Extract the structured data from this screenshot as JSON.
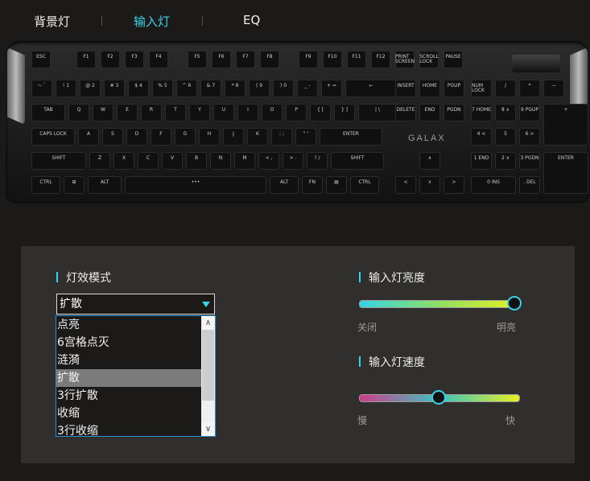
{
  "tabs": [
    {
      "label": "背景灯"
    },
    {
      "label": "输入灯"
    },
    {
      "label": "EQ"
    }
  ],
  "keyboard": {
    "brand": "GALAX",
    "rows": [
      [
        "ESC",
        "F1",
        "F2",
        "F3",
        "F4",
        "F5",
        "F6",
        "F7",
        "F8",
        "F9",
        "F10",
        "F11",
        "F12",
        "PRINT SCREEN",
        "SCROLL LOCK",
        "PAUSE"
      ],
      [
        "~ `",
        "! 1",
        "@ 2",
        "# 3",
        "$ 4",
        "% 5",
        "^ 6",
        "& 7",
        "* 8",
        "( 9",
        ") 0",
        "_ -",
        "+ =",
        "←",
        "INSERT",
        "HOME",
        "PGUP",
        "NUM LOCK",
        "/",
        "*",
        "−"
      ],
      [
        "TAB",
        "Q",
        "W",
        "E",
        "R",
        "T",
        "Y",
        "U",
        "I",
        "O",
        "P",
        "{ [",
        "} ]",
        "| \\",
        "DELETE",
        "END",
        "PGDN",
        "7 HOME",
        "8 ∧",
        "9 PGUP",
        "+"
      ],
      [
        "CAPS LOCK",
        "A",
        "S",
        "D",
        "F",
        "G",
        "H",
        "J",
        "K",
        ": ;",
        "\" '",
        "ENTER",
        "4 <",
        "5",
        "6 >"
      ],
      [
        "SHIFT",
        "Z",
        "X",
        "C",
        "V",
        "B",
        "N",
        "M",
        "< ,",
        "> .",
        "? /",
        "SHIFT",
        "∧",
        "1 END",
        "2 ∨",
        "3 PGDN",
        "ENTER"
      ],
      [
        "CTRL",
        "⊞",
        "ALT",
        "•••",
        "ALT",
        "FN",
        "▤",
        "CTRL",
        "<",
        "∨",
        ">",
        "0 INS",
        ". DEL"
      ]
    ]
  },
  "effect": {
    "title": "灯效模式",
    "selected": "扩散",
    "options": [
      "点亮",
      "6宫格点灭",
      "涟漪",
      "扩散",
      "3行扩散",
      "收缩",
      "3行收缩"
    ]
  },
  "brightness": {
    "title": "输入灯亮度",
    "min_label": "关闭",
    "max_label": "明亮",
    "value_fraction": 1.0
  },
  "speed": {
    "title": "输入灯速度",
    "min_label": "慢",
    "max_label": "快",
    "value_fraction": 0.5
  },
  "colors": {
    "accent": "#35d4e6",
    "brightness_gradient": [
      "#35d4e6",
      "#8fe060",
      "#e8f020"
    ],
    "speed_gradient": [
      "#d03c8c",
      "#3ac4c0",
      "#e8f020"
    ]
  }
}
